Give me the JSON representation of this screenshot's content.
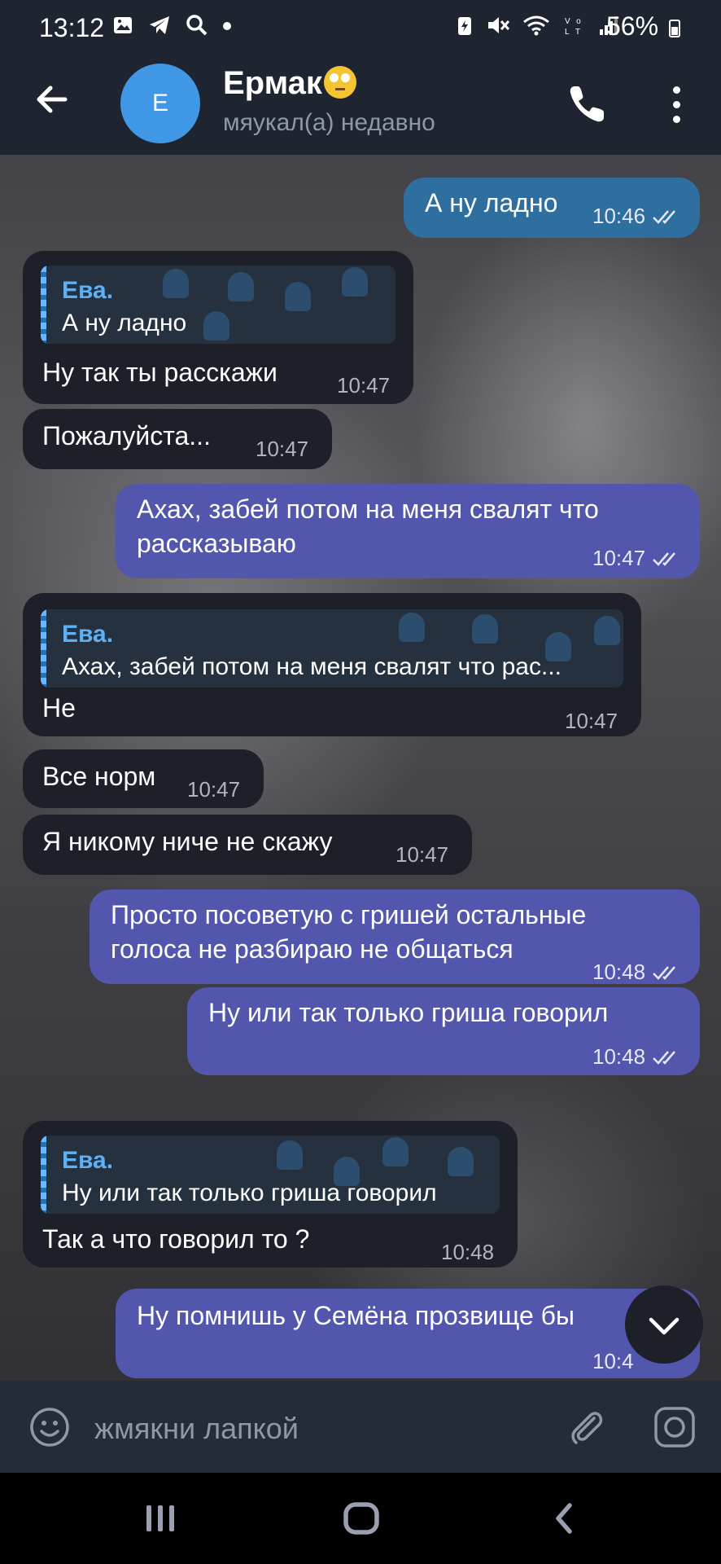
{
  "status_bar": {
    "time": "13:12",
    "battery": "56%"
  },
  "header": {
    "back_icon": "arrow-left-icon",
    "avatar_letter": "E",
    "contact_name": "Ермак",
    "name_emoji": "face-with-rolling-eyes",
    "subtitle": "мяукал(а) недавно"
  },
  "messages": [
    {
      "direction": "out",
      "text": "А ну ладно",
      "time": "10:46",
      "read": true
    },
    {
      "direction": "in",
      "reply_to": {
        "name": "Ева.",
        "text": "А ну ладно"
      },
      "text": "Ну так ты расскажи",
      "time": "10:47"
    },
    {
      "direction": "in",
      "text": "Пожалуйста...",
      "time": "10:47"
    },
    {
      "direction": "out",
      "text_lines": [
        "Ахах, забей потом на меня свалят что",
        "рассказываю"
      ],
      "time": "10:47",
      "read": true
    },
    {
      "direction": "in",
      "reply_to": {
        "name": "Ева.",
        "text": "Ахах, забей потом на меня свалят что рас..."
      },
      "text": "Не",
      "time": "10:47"
    },
    {
      "direction": "in",
      "text": "Все норм",
      "time": "10:47"
    },
    {
      "direction": "in",
      "text": "Я никому ниче не скажу",
      "time": "10:47"
    },
    {
      "direction": "out",
      "text_lines": [
        "Просто посоветую с гришей остальные",
        "голоса не разбираю не общаться"
      ],
      "time": "10:48",
      "read": true
    },
    {
      "direction": "out",
      "text": "Ну или так только гриша говорил",
      "time": "10:48",
      "read": true
    },
    {
      "direction": "in",
      "reply_to": {
        "name": "Ева.",
        "text": "Ну или так только гриша говорил"
      },
      "text": "Так а что говорил то ?",
      "time": "10:48"
    },
    {
      "direction": "out",
      "text": "Ну помнишь у Семёна прозвище бы",
      "time": "10:4",
      "read": true
    }
  ],
  "input": {
    "placeholder": "жмякни лапкой"
  },
  "colors": {
    "header_bg": "#1f2530",
    "incoming_bubble": "#1d2029",
    "outgoing_bubble": "#5257ad",
    "outgoing_bubble_top": "#2f6f9f",
    "accent": "#5eb0f5",
    "avatar": "#3f97e6"
  }
}
